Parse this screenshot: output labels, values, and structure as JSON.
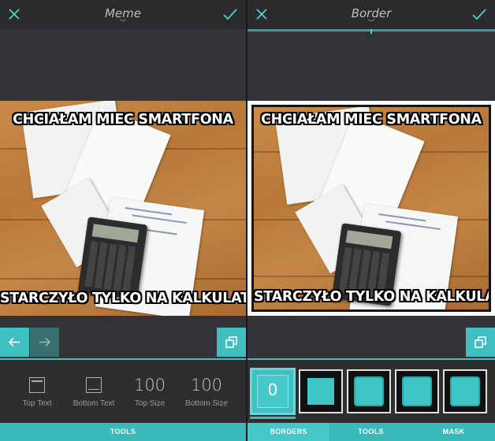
{
  "left": {
    "title": "Meme",
    "caret": "︶",
    "meme": {
      "top_text": "CHCIAŁAM MIEC SMARTFONA",
      "bottom_text": "STARCZYŁO TYLKO NA KALKULATOR"
    },
    "tools": [
      {
        "icon": "top-text-icon",
        "label": "Top Text"
      },
      {
        "icon": "bottom-text-icon",
        "label": "Bottom Text"
      },
      {
        "value": "100",
        "label": "Top Size"
      },
      {
        "value": "100",
        "label": "Bottom Size"
      }
    ],
    "tab": "TOOLS"
  },
  "right": {
    "title": "Border",
    "caret": "︶",
    "meme": {
      "top_text": "CHCIAŁAM MIEC SMARTFONA",
      "bottom_text": "STARCZYŁO TYLKO NA KALKULATOR"
    },
    "selected_border": "0",
    "tabs": [
      "BORDERS",
      "TOOLS",
      "MASK"
    ]
  },
  "colors": {
    "accent": "#3fbfc0",
    "background": "#2d2d31",
    "text": "#bdbdbd"
  }
}
